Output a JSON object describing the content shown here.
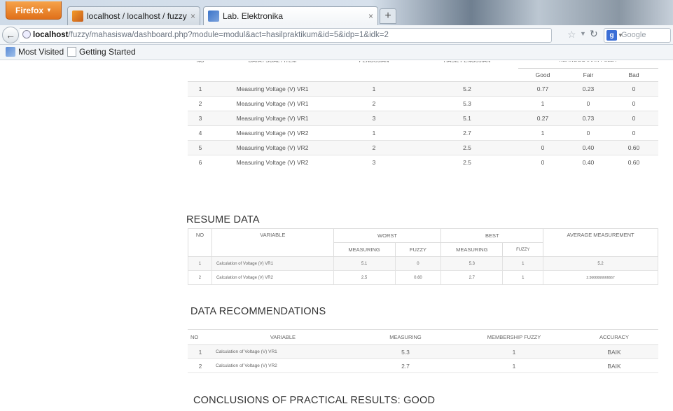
{
  "browser": {
    "firefox_button": "Firefox",
    "tabs": [
      {
        "title": "localhost / localhost / fuzzy | phpMy..."
      },
      {
        "title": "Lab. Elektronika"
      }
    ],
    "new_tab": "+",
    "close_glyph": "×",
    "url_host": "localhost",
    "url_path": "/fuzzy/mahasiswa/dashboard.php?module=modul&act=hasilpraktikum&id=5&idp=1&idk=2",
    "search_placeholder": "Google",
    "search_engine_icon": "g",
    "bookmarks": [
      "Most Visited",
      "Getting Started"
    ],
    "icons": {
      "back": "back-arrow-icon",
      "star": "bookmark-star-icon",
      "reload": "reload-icon"
    }
  },
  "results_table": {
    "headers": {
      "no": "NO",
      "data": "DATA / SOAL / ITEM",
      "testing": "PENGUJIAN",
      "result": "HASIL PENGUJIAN",
      "fuzzy": "KEANGGOTAAN FUZZY",
      "good": "Good",
      "fair": "Fair",
      "bad": "Bad"
    },
    "rows": [
      {
        "no": "1",
        "item": "Measuring Voltage (V) VR1",
        "test": "1",
        "result": "5.2",
        "good": "0.77",
        "fair": "0.23",
        "bad": "0"
      },
      {
        "no": "2",
        "item": "Measuring Voltage (V) VR1",
        "test": "2",
        "result": "5.3",
        "good": "1",
        "fair": "0",
        "bad": "0"
      },
      {
        "no": "3",
        "item": "Measuring Voltage (V) VR1",
        "test": "3",
        "result": "5.1",
        "good": "0.27",
        "fair": "0.73",
        "bad": "0"
      },
      {
        "no": "4",
        "item": "Measuring Voltage (V) VR2",
        "test": "1",
        "result": "2.7",
        "good": "1",
        "fair": "0",
        "bad": "0"
      },
      {
        "no": "5",
        "item": "Measuring Voltage (V) VR2",
        "test": "2",
        "result": "2.5",
        "good": "0",
        "fair": "0.40",
        "bad": "0.60"
      },
      {
        "no": "6",
        "item": "Measuring Voltage (V) VR2",
        "test": "3",
        "result": "2.5",
        "good": "0",
        "fair": "0.40",
        "bad": "0.60"
      }
    ]
  },
  "resume": {
    "title": "RESUME DATA",
    "headers": {
      "no": "NO",
      "variable": "VARIABLE",
      "worst": "WORST",
      "best": "BEST",
      "average": "AVERAGE MEASUREMENT",
      "measuring": "MEASURING",
      "fuzzy": "FUZZY"
    },
    "rows": [
      {
        "no": "1",
        "variable": "Calculation of Voltage (V) VR1",
        "worst_measuring": "5.1",
        "worst_fuzzy": "0",
        "best_measuring": "5.3",
        "best_fuzzy": "1",
        "average": "5.2"
      },
      {
        "no": "2",
        "variable": "Calculation of Voltage (V) VR2",
        "worst_measuring": "2.5",
        "worst_fuzzy": "0.60",
        "best_measuring": "2.7",
        "best_fuzzy": "1",
        "average": "2.5666666666667"
      }
    ]
  },
  "recommendations": {
    "title": "DATA RECOMMENDATIONS",
    "headers": {
      "no": "NO",
      "variable": "VARIABLE",
      "measuring": "MEASURING",
      "membership": "MEMBERSHIP FUZZY",
      "accuracy": "ACCURACY"
    },
    "rows": [
      {
        "no": "1",
        "variable": "Calculation of Voltage (V) VR1",
        "measuring": "5.3",
        "membership": "1",
        "accuracy": "BAIK"
      },
      {
        "no": "2",
        "variable": "Calculation of Voltage (V) VR2",
        "measuring": "2.7",
        "membership": "1",
        "accuracy": "BAIK"
      }
    ]
  },
  "conclusion": "CONCLUSIONS OF PRACTICAL RESULTS: GOOD"
}
